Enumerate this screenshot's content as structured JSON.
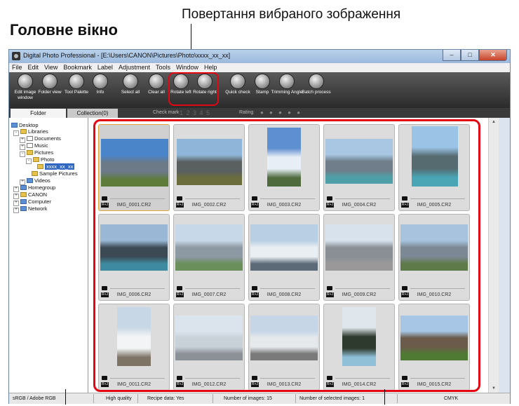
{
  "annotations": {
    "callout": "Повертання вибраного зображення",
    "page_title": "Головне вікно"
  },
  "window": {
    "title": "Digital Photo Professional - [E:\\Users\\CANON\\Pictures\\Photo\\xxxx_xx_xx]"
  },
  "menu": [
    "File",
    "Edit",
    "View",
    "Bookmark",
    "Label",
    "Adjustment",
    "Tools",
    "Window",
    "Help"
  ],
  "toolbar": {
    "edit_image_window": "Edit image window",
    "folder_view": "Folder view",
    "tool_palette": "Tool Palette",
    "info": "Info",
    "select_all": "Select all",
    "clear_all": "Clear all",
    "rotate_left": "Rotate left",
    "rotate_right": "Rotate right",
    "quick_check": "Quick check",
    "stamp": "Stamp",
    "trimming_angle": "Trimming Angle",
    "batch_process": "Batch process"
  },
  "tabs": {
    "folder": "Folder",
    "collection": "Collection(0)",
    "check_mark_label": "Check mark",
    "check_mark_values": "1 2 3 4 5",
    "rating_label": "Rating",
    "rating_dots": "● ● ● ● ●"
  },
  "tree": {
    "desktop": "Desktop",
    "libraries": "Libraries",
    "documents": "Documents",
    "music": "Music",
    "pictures": "Pictures",
    "photo": "Photo",
    "selected_folder": "xxxx_xx_xx",
    "sample_pictures": "Sample Pictures",
    "videos": "Videos",
    "homegroup": "Homegroup",
    "canon": "CANON",
    "computer": "Computer",
    "network": "Network"
  },
  "thumbnails": [
    {
      "name": "IMG_0001.CR2",
      "selected": true
    },
    {
      "name": "IMG_0002.CR2"
    },
    {
      "name": "IMG_0003.CR2"
    },
    {
      "name": "IMG_0004.CR2"
    },
    {
      "name": "IMG_0005.CR2"
    },
    {
      "name": "IMG_0006.CR2"
    },
    {
      "name": "IMG_0007.CR2"
    },
    {
      "name": "IMG_0008.CR2"
    },
    {
      "name": "IMG_0009.CR2"
    },
    {
      "name": "IMG_0010.CR2"
    },
    {
      "name": "IMG_0011.CR2"
    },
    {
      "name": "IMG_0012.CR2"
    },
    {
      "name": "IMG_0013.CR2"
    },
    {
      "name": "IMG_0014.CR2"
    },
    {
      "name": "IMG_0015.CR2"
    }
  ],
  "thumb_badge": "R+J",
  "status": {
    "color_space": "sRGB / Adobe RGB",
    "quality": "High quality",
    "recipe": "Recipe data: Yes",
    "num_images": "Number of images: 15",
    "num_selected": "Number of selected images: 1",
    "cmyk": "CMYK"
  },
  "colors": {
    "highlight": "#e30613",
    "selection": "#e3a23a"
  }
}
